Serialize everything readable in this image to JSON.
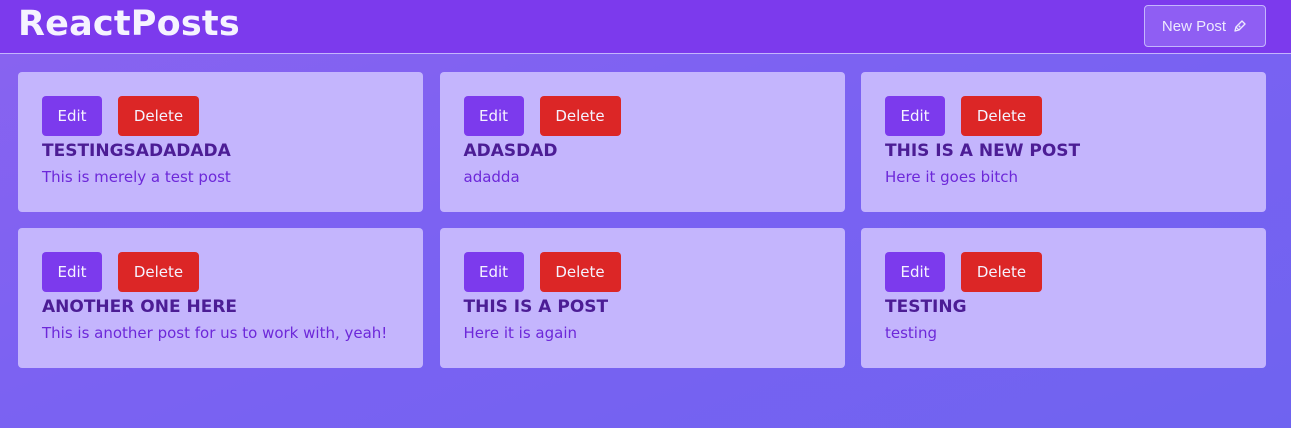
{
  "header": {
    "brand": "ReactPosts",
    "new_post_label": "New Post",
    "new_post_icon": "pen-icon"
  },
  "card_actions": {
    "edit_label": "Edit",
    "delete_label": "Delete"
  },
  "posts": [
    {
      "title": "TESTINGSADADADA",
      "body": "This is merely a test post"
    },
    {
      "title": "ADASDAD",
      "body": "adadda"
    },
    {
      "title": "THIS IS A NEW POST",
      "body": "Here it goes bitch"
    },
    {
      "title": "ANOTHER ONE HERE",
      "body": "This is another post for us to work with, yeah!"
    },
    {
      "title": "THIS IS A POST",
      "body": "Here it is again"
    },
    {
      "title": "TESTING",
      "body": "testing"
    }
  ],
  "colors": {
    "header_bg": "#7c3aed",
    "card_bg": "#c4b5fd",
    "edit_button": "#7c3aed",
    "delete_button": "#dc2626",
    "title_text": "#4c1d95",
    "body_text": "#6d28d9"
  }
}
